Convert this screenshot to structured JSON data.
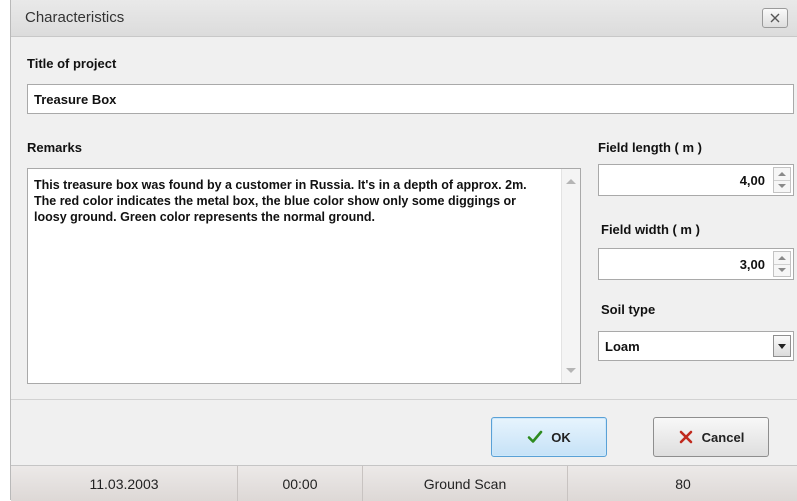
{
  "window": {
    "title": "Characteristics"
  },
  "project": {
    "title_label": "Title of project",
    "title_value": "Treasure Box"
  },
  "remarks": {
    "label": "Remarks",
    "text": "This treasure box was found by a customer in Russia. It's in a depth of approx. 2m. The red color indicates the metal box, the blue color show only some diggings or loosy ground. Green color represents the normal ground."
  },
  "field": {
    "length_label": "Field length ( m )",
    "length_value": "4,00",
    "width_label": "Field width ( m )",
    "width_value": "3,00"
  },
  "soil": {
    "label": "Soil type",
    "value": "Loam"
  },
  "buttons": {
    "ok_label": "OK",
    "cancel_label": "Cancel"
  },
  "status": {
    "date": "11.03.2003",
    "time": "00:00",
    "mode": "Ground Scan",
    "value": "80"
  },
  "icons": {
    "ok": "checkmark-icon",
    "cancel": "cross-icon",
    "close": "close-icon"
  },
  "colors": {
    "ok_check": "#2e8b1f",
    "cancel_cross": "#c0291d",
    "ok_border": "#5aa1d6"
  }
}
